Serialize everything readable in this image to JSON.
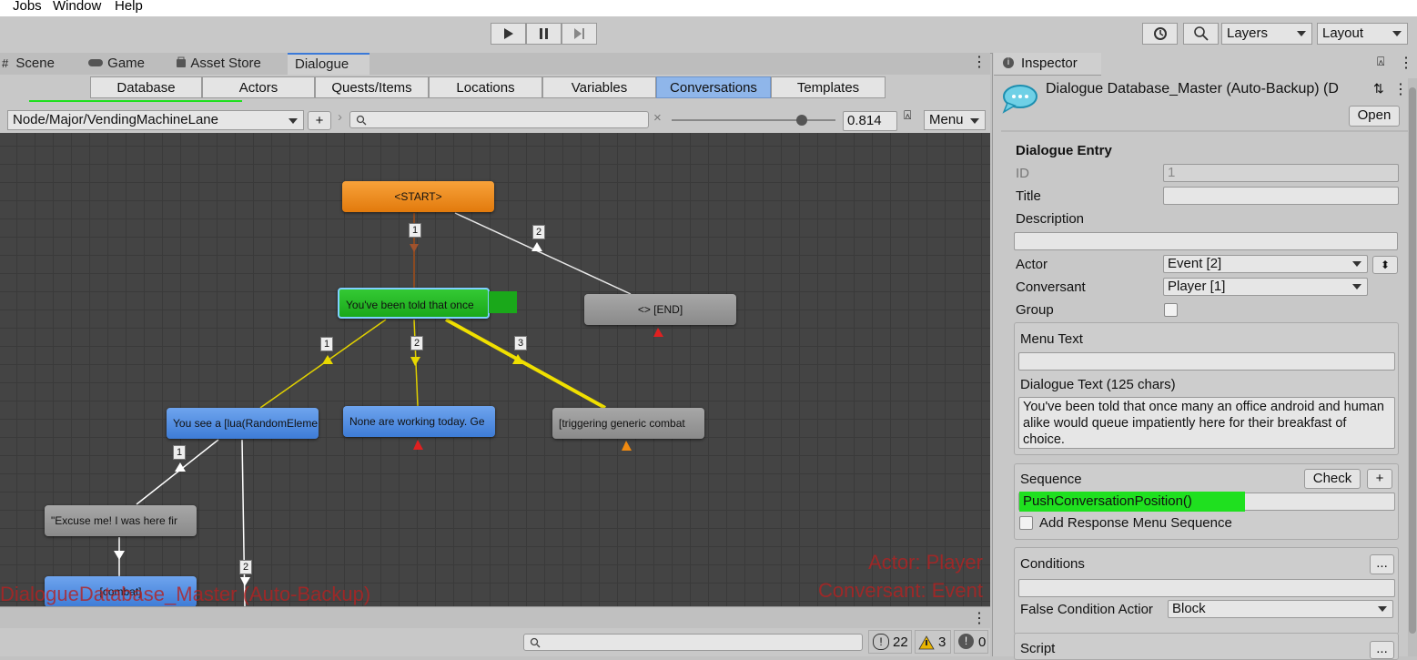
{
  "menubar": {
    "items": [
      "Jobs",
      "Window",
      "Help"
    ]
  },
  "toolbar": {
    "layers_label": "Layers",
    "layout_label": "Layout"
  },
  "left_tabs": [
    {
      "label": "Scene",
      "icon": "grid-icon"
    },
    {
      "label": "Game",
      "icon": "gamepad-icon"
    },
    {
      "label": "Asset Store",
      "icon": "bag-icon"
    },
    {
      "label": "Dialogue",
      "icon": ""
    }
  ],
  "sub_tabs": [
    "Database",
    "Actors",
    "Quests/Items",
    "Locations",
    "Variables",
    "Conversations",
    "Templates"
  ],
  "pathbar": {
    "conversation": "Node/Major/VendingMachineLane",
    "add": "+",
    "zoom_value": "0.814",
    "zoom_level": 0.814,
    "menu_label": "Menu",
    "search_placeholder": ""
  },
  "canvas": {
    "nodes": {
      "start": "<START>",
      "selected": "You've been told that once",
      "end": "<> [END]",
      "n1": "You see a [lua(RandomEleme",
      "n2": "None are working today. Ge",
      "n3": "[triggering generic combat",
      "n4": "\"Excuse me! I was here fir",
      "n5": "[combat]"
    },
    "links": {
      "l1": "1",
      "l2": "2",
      "l3": "1",
      "l4": "2",
      "l5": "3",
      "l6": "1",
      "l7": "2"
    },
    "overlay_left": "DialogueDatabase_Master (Auto-Backup)",
    "overlay_actor": "Actor: Player",
    "overlay_conversant": "Conversant: Event"
  },
  "status": {
    "errors": "22",
    "warnings": "3",
    "messages": "0"
  },
  "inspector": {
    "tab_label": "Inspector",
    "title": "Dialogue Database_Master (Auto-Backup) (D",
    "open_label": "Open",
    "section": "Dialogue Entry",
    "id_label": "ID",
    "id_value": "1",
    "title_label": "Title",
    "title_value": "",
    "description_label": "Description",
    "description_value": "",
    "actor_label": "Actor",
    "actor_value": "Event [2]",
    "conversant_label": "Conversant",
    "conversant_value": "Player [1]",
    "group_label": "Group",
    "menu_text_label": "Menu Text",
    "menu_text_value": "",
    "dialogue_text_label": "Dialogue Text (125 chars)",
    "dialogue_text_value": "You've been told that once many an office android and human alike would queue impatiently here for their breakfast of choice.",
    "sequence_label": "Sequence",
    "check_label": "Check",
    "plus_label": "+",
    "sequence_value": "PushConversationPosition()",
    "add_response_label": "Add Response Menu Sequence",
    "conditions_label": "Conditions",
    "conditions_value": "",
    "ellipsis": "...",
    "false_condition_label": "False Condition Actior",
    "false_condition_value": "Block",
    "script_label": "Script"
  },
  "colors": {
    "accent": "#3a79d8",
    "highlight": "#1fe01f",
    "node_orange": "#f29020",
    "node_blue": "#4f8ee2",
    "node_grey": "#999999"
  }
}
